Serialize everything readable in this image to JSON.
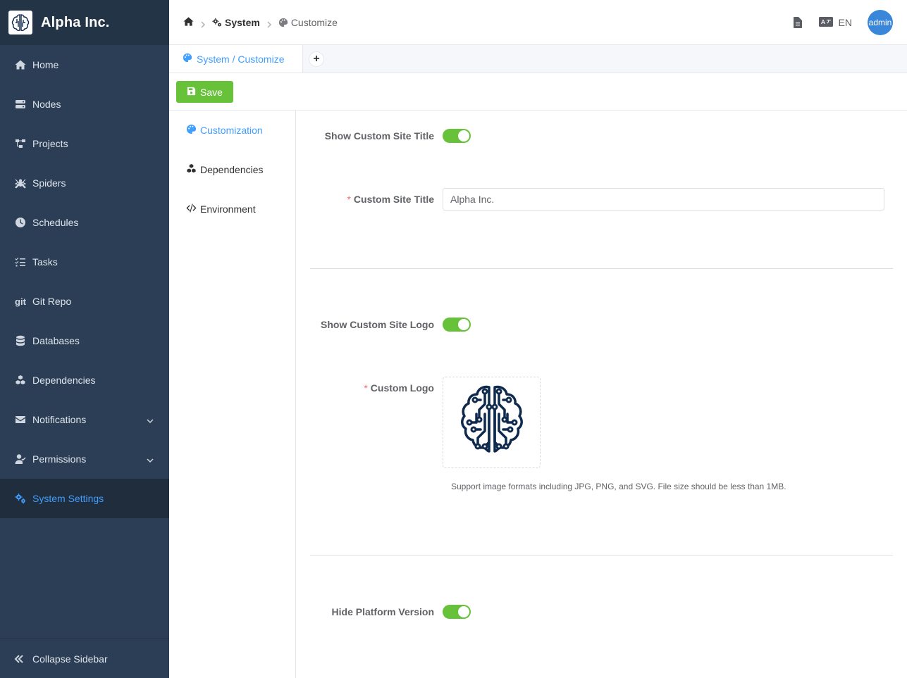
{
  "app": {
    "title": "Alpha Inc.",
    "logo_icon": "brain-circuit-icon"
  },
  "sidebar": {
    "items": [
      {
        "label": "Home",
        "icon": "home-icon"
      },
      {
        "label": "Nodes",
        "icon": "server-icon"
      },
      {
        "label": "Projects",
        "icon": "project-diagram-icon"
      },
      {
        "label": "Spiders",
        "icon": "spider-icon"
      },
      {
        "label": "Schedules",
        "icon": "clock-icon"
      },
      {
        "label": "Tasks",
        "icon": "tasks-icon"
      },
      {
        "label": "Git Repo",
        "icon": "git-icon",
        "icon_text": "git"
      },
      {
        "label": "Databases",
        "icon": "database-icon"
      },
      {
        "label": "Dependencies",
        "icon": "cubes-icon"
      },
      {
        "label": "Notifications",
        "icon": "envelope-icon",
        "has_submenu": true
      },
      {
        "label": "Permissions",
        "icon": "user-check-icon",
        "has_submenu": true
      },
      {
        "label": "System Settings",
        "icon": "cogs-icon",
        "active": true
      }
    ],
    "collapse_label": "Collapse Sidebar"
  },
  "header": {
    "breadcrumb": {
      "home_icon": "home-icon",
      "system": "System",
      "current": "Customize"
    },
    "lang": "EN",
    "user": "admin"
  },
  "tabs": [
    {
      "label": "System / Customize",
      "active": true
    }
  ],
  "toolbar": {
    "save_label": "Save"
  },
  "submenu": {
    "items": [
      {
        "label": "Customization",
        "icon": "palette-icon",
        "active": true
      },
      {
        "label": "Dependencies",
        "icon": "cubes-icon"
      },
      {
        "label": "Environment",
        "icon": "code-icon"
      }
    ]
  },
  "form": {
    "show_title_label": "Show Custom Site Title",
    "show_title_on": true,
    "title_label": "Custom Site Title",
    "title_value": "Alpha Inc.",
    "show_logo_label": "Show Custom Site Logo",
    "show_logo_on": true,
    "logo_label": "Custom Logo",
    "logo_hint": "Support image formats including JPG, PNG, and SVG. File size should be less than 1MB.",
    "hide_version_label": "Hide Platform Version",
    "hide_version_on": true
  },
  "colors": {
    "sidebar": "#2c3e55",
    "accent": "#409eff",
    "success": "#67c23a",
    "brand_logo": "#0f2a4d"
  }
}
